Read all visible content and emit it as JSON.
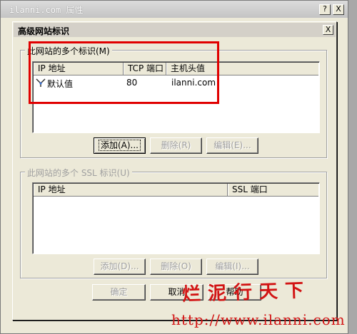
{
  "bg_window": {
    "title": "ilanni.com 属性",
    "help": "?",
    "close": "X",
    "bottom_text": "确定",
    "bottom_text2": "帮助"
  },
  "dialog": {
    "title": "高级网站标识",
    "close": "X",
    "group1": {
      "legend": "此网站的多个标识(M)",
      "columns": [
        "IP 地址",
        "TCP 端口",
        "主机头值"
      ],
      "rows": [
        {
          "ip": "默认值",
          "port": "80",
          "host": "ilanni.com"
        }
      ],
      "buttons": {
        "add": "添加(A)...",
        "delete": "删除(R)",
        "edit": "编辑(E)..."
      }
    },
    "group2": {
      "legend": "此网站的多个 SSL 标识(U)",
      "columns": [
        "IP 地址",
        "SSL 端口"
      ],
      "buttons": {
        "add": "添加(D)...",
        "delete": "删除(O)",
        "edit": "编辑(I)..."
      }
    },
    "footer": {
      "ok": "确定",
      "cancel": "取消",
      "help": "帮助"
    }
  },
  "watermark": {
    "text": "烂泥行天下",
    "url": "http://www.ilanni.com"
  },
  "colors": {
    "highlight": "#e00000",
    "watermark": "#d21414"
  }
}
